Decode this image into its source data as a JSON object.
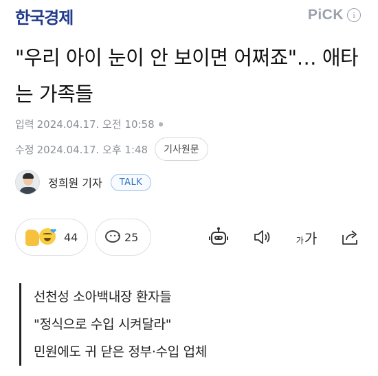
{
  "header": {
    "brand": "한국경제",
    "pick_label": "PiCK",
    "info_icon": "info-icon"
  },
  "article": {
    "title": "\"우리 아이 눈이 안 보이면 어쩌죠\"… 애타는 가족들",
    "published_label": "입력",
    "published_at": "2024.04.17. 오전 10:58",
    "modified_label": "수정",
    "modified_at": "2024.04.17. 오후 1:48",
    "original_button": "기사원문",
    "reporter_name": "정희원 기자",
    "talk_button": "TALK",
    "subheads": [
      "선천성 소아백내장 환자들",
      "\"정식으로 수입 시켜달라\"",
      "민원에도 귀 닫은 정부·수입 업체"
    ]
  },
  "actions": {
    "reaction_count": "44",
    "comment_count": "25",
    "font_small": "가",
    "font_big": "가",
    "icons": [
      "reaction-icon",
      "comment-icon",
      "summary-bot-icon",
      "speaker-icon",
      "font-size-icon",
      "share-icon"
    ]
  },
  "colors": {
    "brand": "#1f3a8a",
    "meta_text": "#8a8f96",
    "talk_accent": "#2f73c9"
  }
}
